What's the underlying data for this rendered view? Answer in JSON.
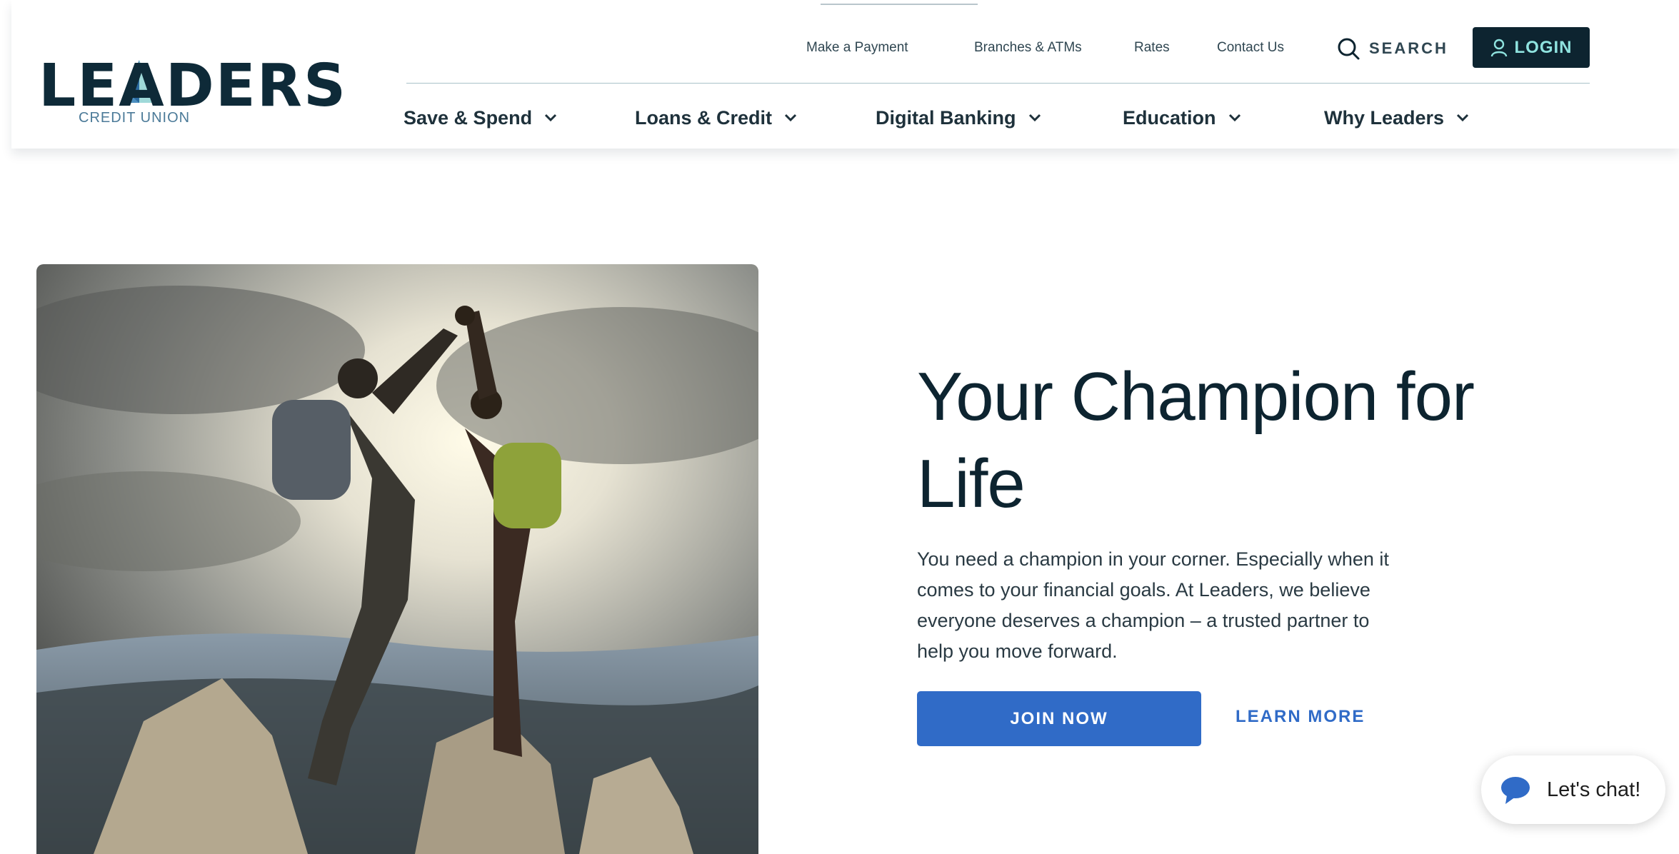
{
  "brand": {
    "logo_word": "LEADERS",
    "logo_sub": "CREDIT UNION",
    "colors": {
      "navy": "#0d2430",
      "teal": "#8fe3df",
      "blue": "#306bc7"
    }
  },
  "utility_nav": [
    {
      "label": "Make a Payment"
    },
    {
      "label": "Branches & ATMs"
    },
    {
      "label": "Rates"
    },
    {
      "label": "Contact Us"
    }
  ],
  "search": {
    "label": "SEARCH",
    "icon": "search-icon"
  },
  "login": {
    "label": "LOGIN",
    "icon": "user-icon"
  },
  "main_nav": [
    {
      "label": "Save & Spend"
    },
    {
      "label": "Loans & Credit"
    },
    {
      "label": "Digital Banking"
    },
    {
      "label": "Education"
    },
    {
      "label": "Why Leaders"
    }
  ],
  "hero": {
    "title": "Your Champion for Life",
    "text": "You need a champion in your corner. Especially when it comes to your financial goals. At Leaders, we believe everyone deserves a champion – a trusted partner to help you move forward.",
    "primary_button": "JOIN NOW",
    "secondary_link": "LEARN MORE"
  },
  "chat": {
    "label": "Let's chat!",
    "icon": "chat-bubble-icon"
  }
}
